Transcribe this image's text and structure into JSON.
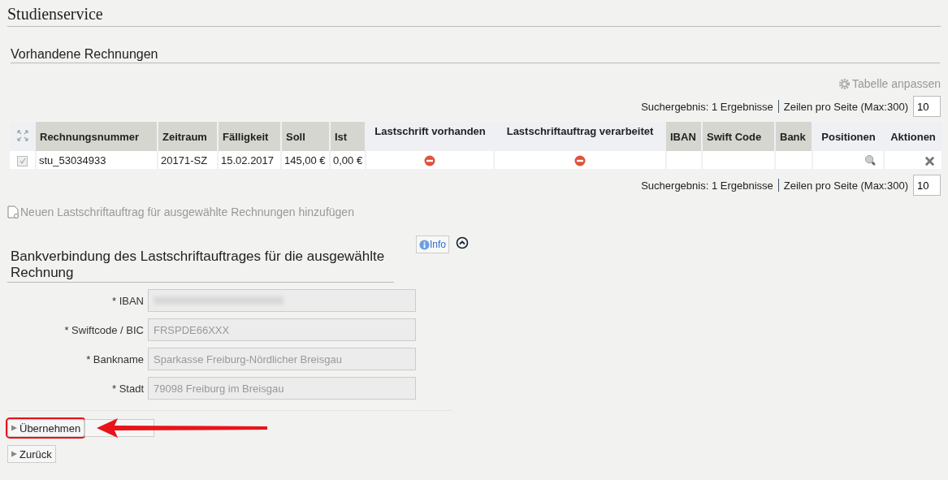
{
  "page_title": "Studienservice",
  "section_title": "Vorhandene Rechnungen",
  "customize_link": "Tabelle anpassen",
  "pager_top": {
    "result": "Suchergebnis: 1 Ergebnisse",
    "rows_label": "Zeilen pro Seite (Max:300)",
    "rows_value": "10"
  },
  "table": {
    "columns": [
      {
        "label": "Rechnungsnummer",
        "sortable": true
      },
      {
        "label": "Zeitraum",
        "sortable": true
      },
      {
        "label": "Fälligkeit",
        "sortable": true
      },
      {
        "label": "Soll",
        "sortable": true
      },
      {
        "label": "Ist",
        "sortable": true
      },
      {
        "label": "Lastschrift vorhanden",
        "sortable": false
      },
      {
        "label": "Lastschriftauftrag verarbeitet",
        "sortable": false
      },
      {
        "label": "IBAN",
        "sortable": true
      },
      {
        "label": "Swift Code",
        "sortable": true
      },
      {
        "label": "Bank",
        "sortable": true
      },
      {
        "label": "Positionen",
        "sortable": false
      },
      {
        "label": "Aktionen",
        "sortable": false
      }
    ],
    "rows": [
      {
        "checked": true,
        "cells": [
          {
            "kind": "text",
            "text": "stu_53034933"
          },
          {
            "kind": "text",
            "text": "20171-SZ"
          },
          {
            "kind": "text",
            "text": "15.02.2017"
          },
          {
            "kind": "text",
            "text": "145,00 €"
          },
          {
            "kind": "text",
            "text": "0,00 €"
          },
          {
            "kind": "flag",
            "on": false
          },
          {
            "kind": "flag",
            "on": false
          },
          {
            "kind": "empty"
          },
          {
            "kind": "empty"
          },
          {
            "kind": "empty"
          },
          {
            "kind": "magnifier"
          },
          {
            "kind": "delete"
          }
        ]
      }
    ]
  },
  "pager_bottom": {
    "result": "Suchergebnis: 1 Ergebnisse",
    "rows_label": "Zeilen pro Seite (Max:300)",
    "rows_value": "10"
  },
  "add_link": "Neuen Lastschriftauftrag für ausgewählte Rechnungen hinzufügen",
  "bank_section": {
    "title": "Bankverbindung des Lastschriftauftrages für die ausgewählte Rechnung",
    "info_button": "Info",
    "fields": [
      {
        "label": "* IBAN",
        "blurred": true
      },
      {
        "label": "* Swiftcode / BIC",
        "value": "FRSPDE66XXX",
        "blurred": false
      },
      {
        "label": "* Bankname",
        "value": "Sparkasse Freiburg-Nördlicher Breisgau",
        "blurred": false
      },
      {
        "label": "* Stadt",
        "value": "79098 Freiburg im Breisgau",
        "blurred": false
      }
    ]
  },
  "buttons": [
    {
      "label": "Übernehmen",
      "highlighted": true
    },
    {
      "label": "Zurück",
      "highlighted": false
    }
  ]
}
